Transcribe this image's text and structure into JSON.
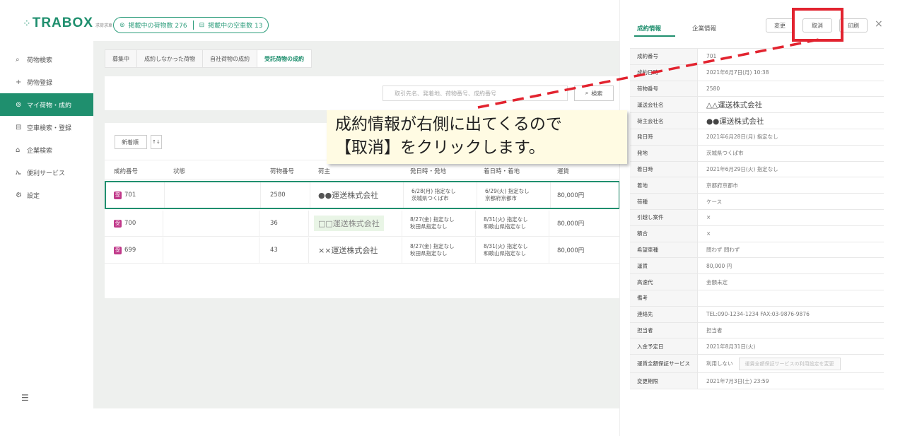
{
  "header": {
    "logo_mark": "⁘",
    "logo_text": "TRABOX",
    "logo_sub": "求荷求車",
    "posted_cargo": "掲載中の荷物数 276",
    "posted_trucks": "掲載中の空車数 13"
  },
  "sidebar": {
    "items": [
      {
        "label": "荷物検索",
        "icon": "search-icon"
      },
      {
        "label": "荷物登録",
        "icon": "plus-icon"
      },
      {
        "label": "マイ荷物・成約",
        "icon": "box-icon"
      },
      {
        "label": "空車検索・登録",
        "icon": "truck-icon"
      },
      {
        "label": "企業検索",
        "icon": "building-icon"
      },
      {
        "label": "便利サービス",
        "icon": "people-icon"
      },
      {
        "label": "設定",
        "icon": "gear-icon"
      }
    ],
    "bottom_icon": "collapse-menu-icon"
  },
  "main": {
    "tabs": [
      "募集中",
      "成約しなかった荷物",
      "自社荷物の成約",
      "受託荷物の成約"
    ],
    "search_placeholder": "取引先名、発着地、荷物番号、成約番号",
    "search_button": "検索",
    "sort_label": "新着順",
    "sort_toggle": "↑↓",
    "columns": [
      "成約番号",
      "状態",
      "荷物番号",
      "荷主",
      "発日時・発地",
      "着日時・着地",
      "運賃"
    ],
    "rows": [
      {
        "id": "701",
        "status": "",
        "cargo_no": "2580",
        "shipper": "●●運送株式会社",
        "dep1": "6/28(月) 指定なし",
        "dep2": "茨城県つくば市",
        "arr1": "6/29(火) 指定なし",
        "arr2": "京都府京都市",
        "fare": "80,000円"
      },
      {
        "id": "700",
        "status": "",
        "cargo_no": "36",
        "shipper": "□□運送株式会社",
        "dep1": "8/27(金) 指定なし",
        "dep2": "秋田県指定なし",
        "arr1": "8/31(火) 指定なし",
        "arr2": "和歌山県指定なし",
        "fare": "80,000円"
      },
      {
        "id": "699",
        "status": "",
        "cargo_no": "43",
        "shipper": "××運送株式会社",
        "dep1": "8/27(金) 指定なし",
        "dep2": "秋田県指定なし",
        "arr1": "8/31(火) 指定なし",
        "arr2": "和歌山県指定なし",
        "fare": "80,000円"
      }
    ]
  },
  "panel": {
    "tab_contract": "成約情報",
    "tab_company": "企業情報",
    "btn_change": "変更",
    "btn_cancel": "取消",
    "btn_print": "印刷",
    "close": "×",
    "rows": [
      {
        "k": "成約番号",
        "v": "701"
      },
      {
        "k": "成約日時",
        "v": "2021年6月7日(月) 10:38"
      },
      {
        "k": "荷物番号",
        "v": "2580"
      },
      {
        "k": "運送会社名",
        "v": "△△運送株式会社"
      },
      {
        "k": "荷主会社名",
        "v": "●●運送株式会社"
      },
      {
        "k": "発日時",
        "v": "2021年6月28日(月) 指定なし"
      },
      {
        "k": "発地",
        "v": "茨城県つくば市"
      },
      {
        "k": "着日時",
        "v": "2021年6月29日(火) 指定なし"
      },
      {
        "k": "着地",
        "v": "京都府京都市"
      },
      {
        "k": "荷種",
        "v": "ケース"
      },
      {
        "k": "引越し案件",
        "v": "×"
      },
      {
        "k": "積合",
        "v": "×"
      },
      {
        "k": "希望車種",
        "v": "問わず 問わず"
      },
      {
        "k": "運賃",
        "v": "80,000 円"
      },
      {
        "k": "高速代",
        "v": "金額未定"
      },
      {
        "k": "備考",
        "v": ""
      },
      {
        "k": "連絡先",
        "v": "TEL:090-1234-1234 FAX:03-9876-9876"
      },
      {
        "k": "担当者",
        "v": "担当者"
      },
      {
        "k": "入金予定日",
        "v": "2021年8月31日(火)"
      },
      {
        "k": "運賃全額保証サービス",
        "v": "利用しない",
        "extra": "運賃全額保証サービスの利用設定を変更"
      },
      {
        "k": "変更期限",
        "v": "2021年7月3日(土) 23:59"
      }
    ]
  },
  "annotation": {
    "line1": "成約情報が右側に出てくるので",
    "line2": "【取消】をクリックします。"
  },
  "colors": {
    "brand": "#1f8f6e",
    "highlight": "#e2232f",
    "callout_bg": "#fffbe3"
  }
}
